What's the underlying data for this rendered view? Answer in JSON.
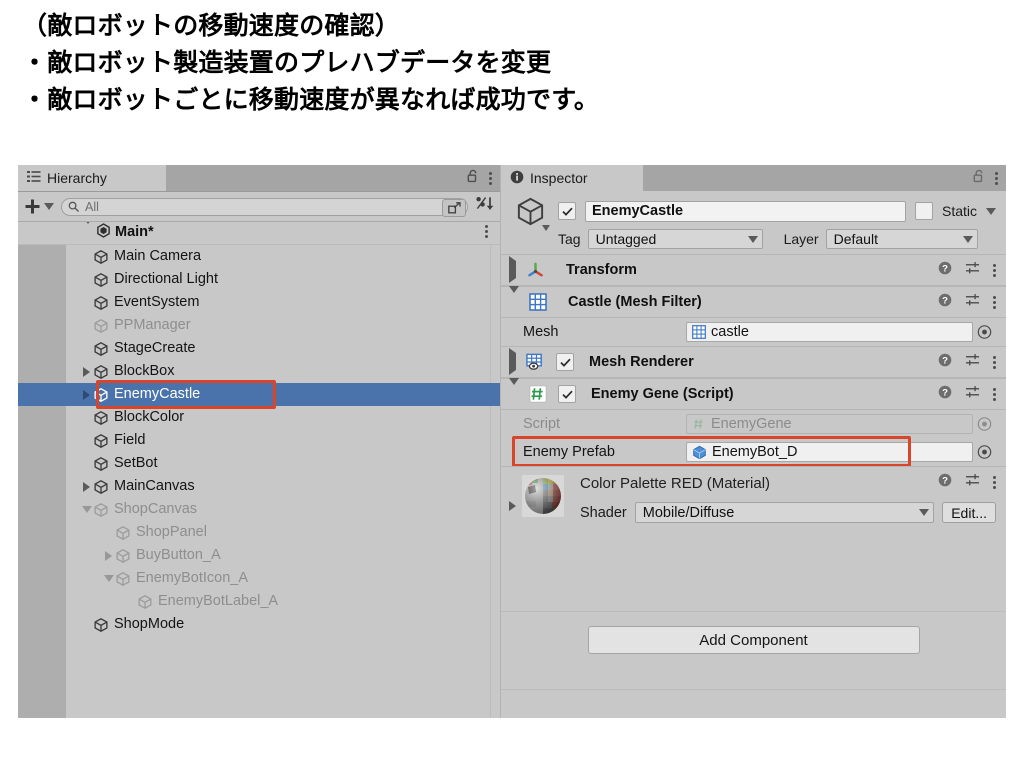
{
  "slide": {
    "lines": [
      "（敵ロボットの移動速度の確認）",
      "・敵ロボット製造装置のプレハブデータを変更",
      "・敵ロボットごとに移動速度が異なれば成功です。"
    ]
  },
  "colors": {
    "selection_blue": "#4a73ab",
    "annotation_red": "#d9452a",
    "panel_gray": "#c8c8c8",
    "tabbar_gray": "#a5a5a5"
  },
  "hierarchy": {
    "tab_label": "Hierarchy",
    "tab_icon": "hierarchy-icon",
    "lock_icon": "lock-open-icon",
    "menu_icon": "kebab-menu-icon",
    "create_label": "+",
    "search": {
      "value": "",
      "placeholder": "All",
      "icon": "search-icon",
      "advanced_icon": "open-search-window-icon"
    },
    "sort_icon": "alphabetical-sort-icon",
    "scene": {
      "name": "Main*",
      "icon": "unity-scene-icon",
      "expanded": true
    },
    "items": [
      {
        "label": "Main Camera",
        "depth": 1,
        "twisty": "none",
        "dim": false,
        "selected": false
      },
      {
        "label": "Directional Light",
        "depth": 1,
        "twisty": "none",
        "dim": false,
        "selected": false
      },
      {
        "label": "EventSystem",
        "depth": 1,
        "twisty": "none",
        "dim": false,
        "selected": false
      },
      {
        "label": "PPManager",
        "depth": 1,
        "twisty": "none",
        "dim": true,
        "selected": false
      },
      {
        "label": "StageCreate",
        "depth": 1,
        "twisty": "none",
        "dim": false,
        "selected": false
      },
      {
        "label": "BlockBox",
        "depth": 1,
        "twisty": "collapsed",
        "dim": false,
        "selected": false
      },
      {
        "label": "EnemyCastle",
        "depth": 1,
        "twisty": "collapsed",
        "dim": false,
        "selected": true
      },
      {
        "label": "BlockColor",
        "depth": 1,
        "twisty": "none",
        "dim": false,
        "selected": false
      },
      {
        "label": "Field",
        "depth": 1,
        "twisty": "none",
        "dim": false,
        "selected": false
      },
      {
        "label": "SetBot",
        "depth": 1,
        "twisty": "none",
        "dim": false,
        "selected": false
      },
      {
        "label": "MainCanvas",
        "depth": 1,
        "twisty": "collapsed",
        "dim": false,
        "selected": false
      },
      {
        "label": "ShopCanvas",
        "depth": 1,
        "twisty": "expanded",
        "dim": true,
        "selected": false
      },
      {
        "label": "ShopPanel",
        "depth": 2,
        "twisty": "none",
        "dim": true,
        "selected": false
      },
      {
        "label": "BuyButton_A",
        "depth": 2,
        "twisty": "collapsed",
        "dim": true,
        "selected": false
      },
      {
        "label": "EnemyBotIcon_A",
        "depth": 2,
        "twisty": "expanded",
        "dim": true,
        "selected": false
      },
      {
        "label": "EnemyBotLabel_A",
        "depth": 3,
        "twisty": "none",
        "dim": true,
        "selected": false
      },
      {
        "label": "ShopMode",
        "depth": 1,
        "twisty": "none",
        "dim": false,
        "selected": false
      }
    ]
  },
  "inspector": {
    "tab_label": "Inspector",
    "tab_icon": "info-icon",
    "lock_icon": "lock-open-icon",
    "menu_icon": "kebab-menu-icon",
    "game_object": {
      "icon": "gameobject-cube-icon",
      "enabled": true,
      "name": "EnemyCastle",
      "static_checked": false,
      "static_label": "Static",
      "tag_label": "Tag",
      "tag_value": "Untagged",
      "layer_label": "Layer",
      "layer_value": "Default"
    },
    "components": [
      {
        "title": "Transform",
        "icon": "transform-axis-icon",
        "expanded": false,
        "has_enable_toggle": false,
        "enabled": false,
        "properties": []
      },
      {
        "title": "Castle (Mesh Filter)",
        "icon": "mesh-filter-grid-icon",
        "expanded": true,
        "has_enable_toggle": false,
        "enabled": false,
        "properties": [
          {
            "label": "Mesh",
            "value": "castle",
            "value_icon": "mesh-grid-icon",
            "disabled": false,
            "highlighted": false
          }
        ]
      },
      {
        "title": "Mesh Renderer",
        "icon": "mesh-renderer-icon",
        "expanded": false,
        "has_enable_toggle": true,
        "enabled": true,
        "properties": []
      },
      {
        "title": "Enemy Gene (Script)",
        "icon": "csharp-script-icon",
        "expanded": true,
        "has_enable_toggle": true,
        "enabled": true,
        "properties": [
          {
            "label": "Script",
            "value": "EnemyGene",
            "value_icon": "csharp-script-icon",
            "disabled": true,
            "highlighted": false
          },
          {
            "label": "Enemy Prefab",
            "value": "EnemyBot_D",
            "value_icon": "prefab-cube-icon",
            "disabled": false,
            "highlighted": true
          }
        ]
      }
    ],
    "material": {
      "title": "Color Palette RED (Material)",
      "preview_icon": "material-sphere-preview",
      "shader_label": "Shader",
      "shader_value": "Mobile/Diffuse",
      "edit_label": "Edit...",
      "help_icon": "help-icon",
      "preset_icon": "preset-sliders-icon",
      "menu_icon": "kebab-menu-icon"
    },
    "add_component_label": "Add Component",
    "comp_header_icons": {
      "help": "help-icon",
      "preset": "preset-sliders-icon",
      "menu": "kebab-menu-icon"
    }
  }
}
